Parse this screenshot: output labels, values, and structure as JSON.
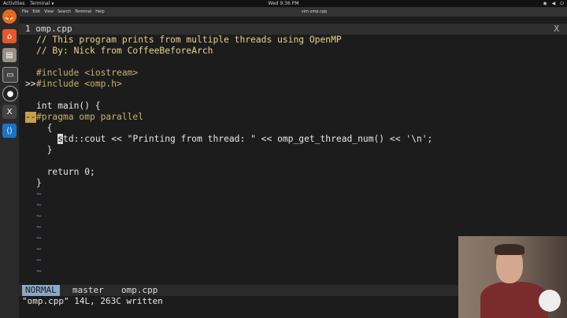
{
  "topbar": {
    "activities": "Activities",
    "app": "Terminal",
    "clock": "Wed 9:36 PM"
  },
  "window": {
    "menus": [
      "File",
      "Edit",
      "View",
      "Search",
      "Terminal",
      "Help"
    ],
    "title": "vim omp.cpp"
  },
  "tabline": {
    "tab_label": "1 omp.cpp",
    "close": "X"
  },
  "editor": {
    "lines": [
      {
        "gutter": "",
        "text": "// This program prints from multiple threads using OpenMP"
      },
      {
        "gutter": "",
        "text": "// By: Nick from CoffeeBeforeArch"
      },
      {
        "gutter": "",
        "text": ""
      },
      {
        "gutter": "",
        "text": "#include <iostream>"
      },
      {
        "gutter": ">>",
        "text": "#include <omp.h>"
      },
      {
        "gutter": "",
        "text": ""
      },
      {
        "gutter": "",
        "text": "int main() {"
      },
      {
        "gutter": "--",
        "text": "#pragma omp parallel"
      },
      {
        "gutter": "",
        "text": "  {"
      },
      {
        "gutter": "",
        "text": "    std::cout << \"Printing from thread: \" << omp_get_thread_num() << '\\n';"
      },
      {
        "gutter": "",
        "text": "  }"
      },
      {
        "gutter": "",
        "text": ""
      },
      {
        "gutter": "",
        "text": "  return 0;"
      },
      {
        "gutter": "",
        "text": "}"
      }
    ],
    "tilde": "~"
  },
  "statusline": {
    "mode": "NORMAL",
    "branch": "master",
    "file": "omp.cpp"
  },
  "cmdline": {
    "message": "\"omp.cpp\" 14L, 263C written"
  }
}
